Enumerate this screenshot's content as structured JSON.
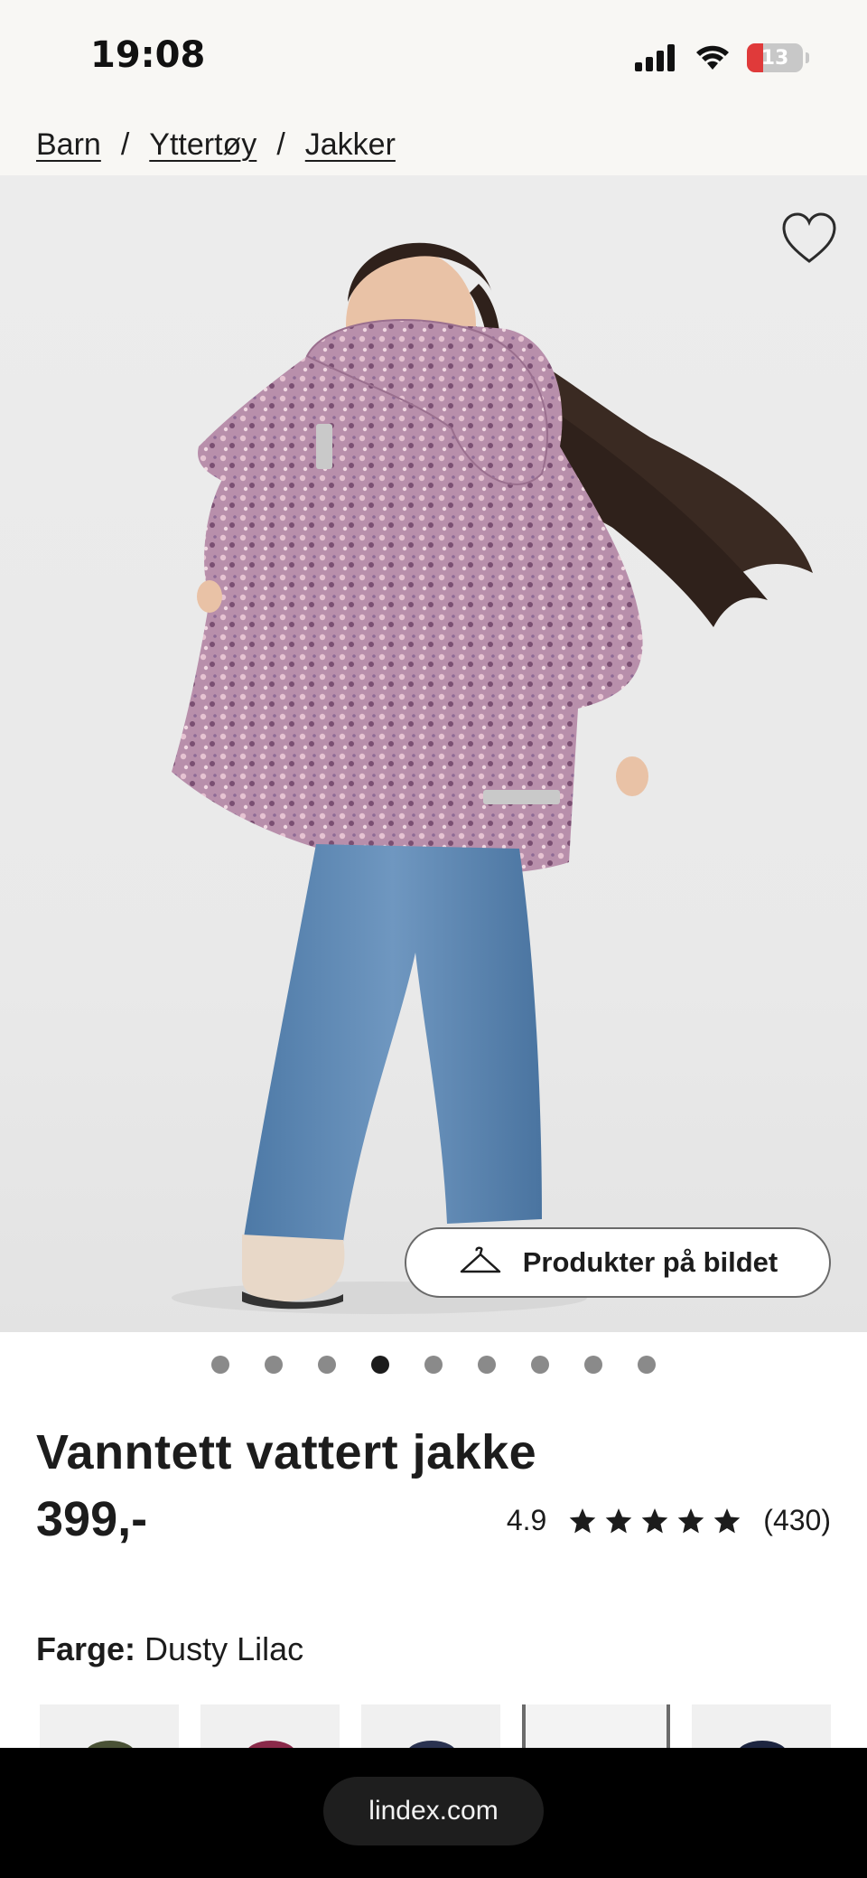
{
  "status_bar": {
    "time": "19:08",
    "battery_level": "13",
    "icons": [
      "signal-icon",
      "wifi-icon",
      "battery-icon"
    ]
  },
  "breadcrumb": {
    "items": [
      "Barn",
      "Yttertøy",
      "Jakker"
    ],
    "separator": "/"
  },
  "hero": {
    "favorite_icon": "heart-outline-icon",
    "products_button_label": "Produkter på bildet",
    "products_button_icon": "hanger-icon"
  },
  "carousel": {
    "total": 9,
    "active_index": 3
  },
  "product": {
    "title": "Vanntett vattert jakke",
    "price": "399,-",
    "rating_value": "4.9",
    "rating_stars": 5,
    "review_count": "(430)"
  },
  "color": {
    "label": "Farge:",
    "value": "Dusty Lilac",
    "swatches": [
      {
        "name": "olive",
        "color": "#4a5236",
        "selected": false
      },
      {
        "name": "raspberry",
        "color": "#8a2a4a",
        "selected": false
      },
      {
        "name": "navy",
        "color": "#2a3250",
        "selected": false
      },
      {
        "name": "dusty-lilac",
        "color": "#b08aa8",
        "selected": true
      },
      {
        "name": "dark-navy",
        "color": "#1d2540",
        "selected": false
      }
    ]
  },
  "browser": {
    "url": "lindex.com"
  },
  "colors": {
    "accent": "#1c1c1c",
    "background_header": "#f8f7f4",
    "jacket": "#b88fab",
    "jeans": "#5a84ad"
  }
}
